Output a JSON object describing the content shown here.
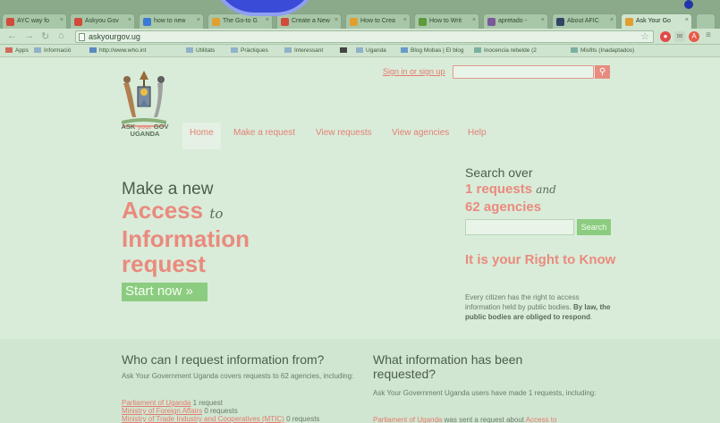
{
  "browser": {
    "tabs": [
      {
        "label": "AYC way fo",
        "color": "#d24a3c"
      },
      {
        "label": "Askyou Gov",
        "color": "#d24a3c"
      },
      {
        "label": "how to new",
        "color": "#3b78d8"
      },
      {
        "label": "The Go-to G",
        "color": "#e0a030"
      },
      {
        "label": "Create a New",
        "color": "#d24a3c"
      },
      {
        "label": "How to Crea",
        "color": "#e0a030"
      },
      {
        "label": "How to Writ",
        "color": "#5c9a3a"
      },
      {
        "label": "apretado - ",
        "color": "#7a5a9a"
      },
      {
        "label": "About AFIC",
        "color": "#334466"
      },
      {
        "label": "Ask Your Go",
        "color": "#e0a030"
      }
    ],
    "url": "askyourgov.ug",
    "bookmarks": [
      "Apps",
      "Informació",
      "http://www.who.int",
      "Utilitats",
      "Pràctiques",
      "Interessant",
      "",
      "Uganda",
      "Blog Mobas | El blog",
      "Inocencia rebelde (2",
      "Misfits (Inadaptados)"
    ]
  },
  "page": {
    "signin": "Sign in or sign up",
    "logo": {
      "line1_a": "ASK ",
      "line1_b": "your",
      "line1_c": " GOV",
      "line2": "UGANDA"
    },
    "nav": [
      "Home",
      "Make a request",
      "View requests",
      "View agencies",
      "Help"
    ],
    "hero": {
      "line1": "Make a new",
      "line2a": "Access ",
      "line2to": "to",
      "line3": "Information",
      "line4": "request",
      "start": "Start now »"
    },
    "search": {
      "over": "Search over",
      "requests": "1 requests",
      "and": "and",
      "agencies": "62 agencies",
      "button": "Search"
    },
    "right": {
      "title": "It is your Right to Know",
      "desc_plain": "Every citizen has the right to access information held by public bodies. ",
      "desc_bold": "By law, the public bodies are obliged to respond",
      "desc_end": "."
    },
    "who": {
      "heading": "Who can I request information from?",
      "intro": "Ask Your Government Uganda covers requests to 62 agencies, including:",
      "items": [
        {
          "link": "Parliament of Uganda",
          "count": " 1 request"
        },
        {
          "link": "Ministry of Foreign Affairs",
          "count": " 0 requests"
        },
        {
          "link": "Ministry of Trade Industry and Cooperatives (MTIC)",
          "count": " 0 requests"
        }
      ]
    },
    "what": {
      "heading": "What information has been requested?",
      "intro": "Ask Your Government Uganda users have made 1 requests, including:",
      "item_link": "Parliament of Uganda",
      "item_text": " was sent a request about ",
      "item_link2": "Access to"
    }
  }
}
